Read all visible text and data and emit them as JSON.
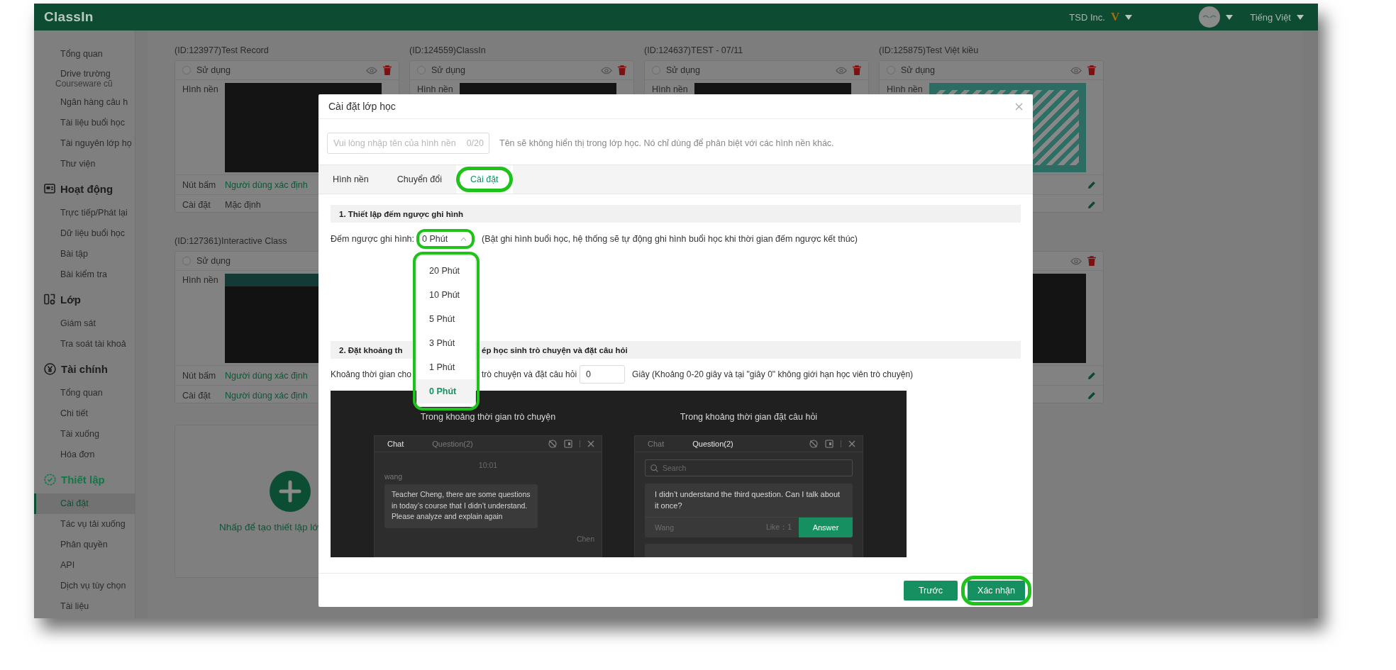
{
  "app": {
    "logo": "ClassIn",
    "org": "TSD Inc.",
    "org_badge": "V",
    "language": "Tiếng Việt"
  },
  "sidebar": {
    "sections": [
      {
        "items": [
          {
            "label": "Tổng quan",
            "selected": false
          },
          {
            "label": "Drive trường",
            "subtitle": "Courseware cũ",
            "selected": false
          },
          {
            "label": "Ngân hàng câu h",
            "selected": false
          },
          {
            "label": "Tài liệu buổi học",
            "selected": false
          },
          {
            "label": "Tài nguyên lớp họ",
            "selected": false
          },
          {
            "label": "Thư viện",
            "selected": false
          }
        ]
      },
      {
        "title": "Hoạt động",
        "active": false,
        "items": [
          {
            "label": "Trực tiếp/Phát lại",
            "selected": false
          },
          {
            "label": "Dữ liệu buổi học",
            "selected": false
          },
          {
            "label": "Bài tập",
            "selected": false
          },
          {
            "label": "Bài kiểm tra",
            "selected": false
          }
        ]
      },
      {
        "title": "Lớp",
        "active": false,
        "items": [
          {
            "label": "Giám sát",
            "selected": false
          },
          {
            "label": "Tra soát tài khoả",
            "selected": false
          }
        ]
      },
      {
        "title": "Tài chính",
        "active": false,
        "items": [
          {
            "label": "Tổng quan",
            "selected": false
          },
          {
            "label": "Chi tiết",
            "selected": false
          },
          {
            "label": "Tài xuống",
            "selected": false
          },
          {
            "label": "Hóa đơn",
            "selected": false
          }
        ]
      },
      {
        "title": "Thiết lập",
        "active": true,
        "items": [
          {
            "label": "Cài đặt",
            "selected": true
          },
          {
            "label": "Tác vụ tải xuống",
            "selected": false
          },
          {
            "label": "Phân quyền",
            "selected": false
          },
          {
            "label": "API",
            "selected": false
          },
          {
            "label": "Dịch vụ tùy chọn",
            "selected": false
          },
          {
            "label": "Tài liệu",
            "selected": false
          }
        ]
      }
    ]
  },
  "templates": {
    "rows": [
      {
        "cards": [
          {
            "title": "(ID:123977)Test Record",
            "use_label": "Sử dụng",
            "selected": false,
            "actions": true,
            "background_label": "Hình nền",
            "preview": {
              "kind": "dark"
            },
            "rows": [
              {
                "label": "Nút bấm",
                "value": "Người dùng xác định",
                "kind": "custom"
              },
              {
                "label": "Cài đặt",
                "value": "Mặc định",
                "kind": "default"
              }
            ]
          },
          {
            "title": "(ID:124559)ClassIn",
            "use_label": "Sử dụng",
            "selected": false,
            "actions": true,
            "background_label": "Hình nền",
            "preview": {
              "kind": "dark"
            }
          },
          {
            "title": "(ID:124637)TEST - 07/11",
            "use_label": "Sử dụng",
            "selected": false,
            "actions": true,
            "background_label": "Hình nền",
            "preview": {
              "kind": "dark"
            }
          },
          {
            "title": "(ID:125875)Test Việt kiều",
            "use_label": "Sử dụng",
            "selected": false,
            "actions": true,
            "background_label": "Hình nền",
            "preview": {
              "kind": "pattern"
            },
            "editable": true
          }
        ]
      },
      {
        "cards": [
          {
            "title": "(ID:127361)Interactive Class",
            "use_label": "Sử dụng",
            "selected": false,
            "background_label": "Hình nền",
            "preview": {
              "kind": "classroom"
            },
            "rows": [
              {
                "label": "Nút bấm",
                "value": "Người dùng xác định",
                "kind": "custom"
              },
              {
                "label": "Cài đặt",
                "value": "Người dùng xác định",
                "kind": "custom"
              }
            ]
          },
          {
            "actions": true,
            "preview": {
              "kind": "dark"
            },
            "editable": true
          }
        ]
      }
    ],
    "create": {
      "label": "Nhấp để tạo thiết lập lớ"
    }
  },
  "dialog": {
    "title": "Cài đặt lớp học",
    "name_field": {
      "placeholder": "Vui lòng nhập tên của hình nền",
      "counter": "0/20"
    },
    "name_hint": "Tên sẽ không hiển thị trong lớp học. Nó chỉ dùng để phân biệt với các hình nền khác.",
    "tabs": [
      {
        "label": "Hình nền",
        "selected": false,
        "highlighted": false
      },
      {
        "label": "Chuyển đổi",
        "selected": false,
        "highlighted": false
      },
      {
        "label": "Cài đặt",
        "selected": true,
        "highlighted": true
      }
    ],
    "section1": {
      "title": "1. Thiết lập đếm ngược ghi hình",
      "label": "Đếm ngược ghi hình:",
      "select": {
        "value": "0 Phút",
        "expanded": true,
        "highlighted": true
      },
      "note": "(Bật ghi hình buổi học, hệ thống sẽ tự động ghi hình buổi học khi thời gian đếm ngược kết thúc)"
    },
    "dropdown": {
      "highlighted": true,
      "options": [
        {
          "label": "20 Phút",
          "selected": false
        },
        {
          "label": "10 Phút",
          "selected": false
        },
        {
          "label": "5 Phút",
          "selected": false
        },
        {
          "label": "3 Phút",
          "selected": false
        },
        {
          "label": "1 Phút",
          "selected": false
        },
        {
          "label": "0 Phút",
          "selected": true
        }
      ]
    },
    "section2": {
      "title_parts": [
        "2. Đặt khoảng th",
        "ép học sinh trò chuyện và đặt câu hỏi"
      ],
      "label_parts": [
        "Khoảng thời gian cho",
        "trò chuyện và đặt câu hỏi"
      ],
      "input": {
        "value": "0"
      },
      "note": "Giây (Khoảng 0-20 giây và tại \"giây 0\" không giới hạn học viên trò chuyện)"
    },
    "example": {
      "panels": [
        {
          "kind": "chat",
          "caption": "Trong khoảng thời gian trò chuyện",
          "tabs": [
            {
              "label": "Chat",
              "selected": true
            },
            {
              "label": "Question(2)",
              "selected": false
            }
          ],
          "time": "10:01",
          "sender": "wang",
          "message": "Teacher Cheng, there are some questions in today’s course that I didn’t understand. Please analyze and explain again",
          "next_sender": "Chen"
        },
        {
          "kind": "questions",
          "caption": "Trong khoảng thời gian đặt câu hỏi",
          "tabs": [
            {
              "label": "Chat",
              "selected": false
            },
            {
              "label": "Question(2)",
              "selected": true
            }
          ],
          "search_placeholder": "Search",
          "question": "I didn’t understand the third question. Can I talk about it once?",
          "author": "Wang",
          "likes": "Like：1",
          "action": "Answer"
        }
      ]
    },
    "buttons": [
      {
        "label": "Trước",
        "kind": "secondary",
        "highlighted": false
      },
      {
        "label": "Xác nhận",
        "kind": "primary",
        "highlighted": true
      }
    ]
  }
}
